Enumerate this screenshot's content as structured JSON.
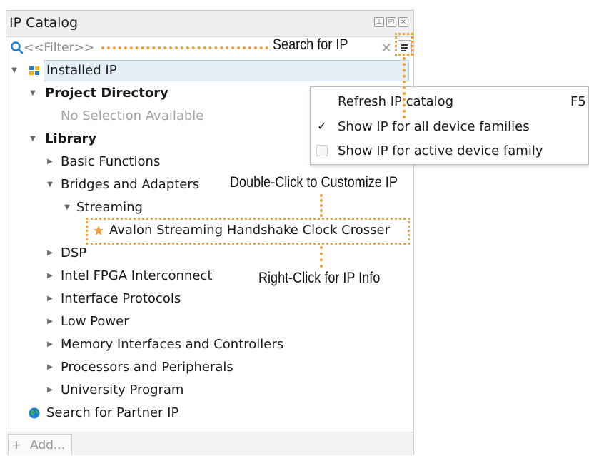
{
  "panel": {
    "title": "IP Catalog",
    "filter_placeholder": "<<Filter>>",
    "add_label": "Add..."
  },
  "tree": {
    "installed_ip": "Installed IP",
    "project_directory": "Project Directory",
    "no_selection": "No Selection Available",
    "library": "Library",
    "basic_functions": "Basic Functions",
    "bridges_and_adapters": "Bridges and Adapters",
    "streaming": "Streaming",
    "avalon_crosser": "Avalon Streaming Handshake Clock Crosser",
    "dsp": "DSP",
    "intel_fpga_interconnect": "Intel FPGA Interconnect",
    "interface_protocols": "Interface Protocols",
    "low_power": "Low Power",
    "memory_interfaces": "Memory Interfaces and Controllers",
    "processors": "Processors and Peripherals",
    "university": "University Program",
    "partner_ip": "Search for Partner IP"
  },
  "menu": {
    "refresh": "Refresh IP catalog",
    "refresh_key": "F5",
    "show_all": "Show IP for all device families",
    "show_all_checked": true,
    "show_active": "Show IP for active device family",
    "show_active_checked": false
  },
  "callouts": {
    "search": "Search for IP",
    "double_click": "Double-Click to Customize IP",
    "right_click": "Right-Click for IP Info"
  },
  "colors": {
    "accent": "#f2a13a",
    "selection": "#e3eef7",
    "search_icon": "#1d7ed6"
  }
}
